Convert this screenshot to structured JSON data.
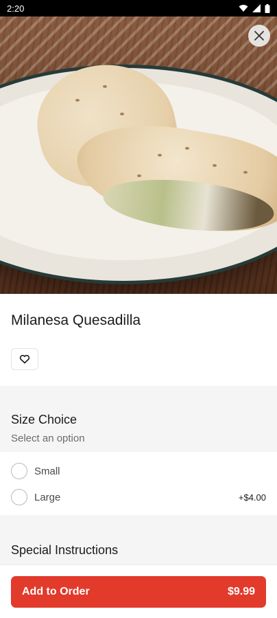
{
  "status_bar": {
    "time": "2:20"
  },
  "item": {
    "name": "Milanesa Quesadilla",
    "image_alt": "quesadilla on a white plate"
  },
  "size_choice": {
    "title": "Size Choice",
    "subtitle": "Select an option",
    "options": [
      {
        "label": "Small",
        "price": ""
      },
      {
        "label": "Large",
        "price": "+$4.00"
      }
    ]
  },
  "special_instructions": {
    "title": "Special Instructions"
  },
  "order_button": {
    "label": "Add to Order",
    "price": "$9.99"
  },
  "colors": {
    "accent": "#e23a2b",
    "section_bg": "#f5f5f5"
  },
  "icons": [
    "wifi-icon",
    "signal-icon",
    "battery-icon",
    "close-icon",
    "heart-icon"
  ]
}
